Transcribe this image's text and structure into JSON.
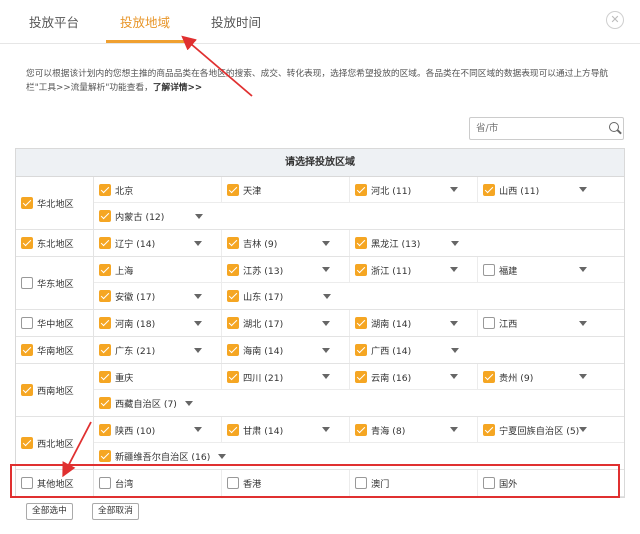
{
  "tabs": [
    {
      "label": "投放平台"
    },
    {
      "label": "投放地域"
    },
    {
      "label": "投放时间"
    }
  ],
  "close_glyph": "✕",
  "description": {
    "text": "您可以根据该计划内的您想主推的商品品类在各地区的搜索、成交、转化表现，选择您希望投放的区域。各品类在不同区域的数据表现可以通过上方导航栏\"工具>>流量解析\"功能查看，",
    "link": "了解详情>>"
  },
  "search": {
    "placeholder": "省/市",
    "icon": "search-icon"
  },
  "grid_title": "请选择投放区域",
  "checkbox_color": "#f5a623",
  "highlight_color": "#e03030",
  "regions": [
    {
      "name": "华北地区",
      "checked": true,
      "rows": [
        [
          {
            "name": "北京",
            "checked": true,
            "dd": false
          },
          {
            "name": "天津",
            "checked": true,
            "dd": false
          },
          {
            "name": "河北 (11)",
            "checked": true,
            "dd": true
          },
          {
            "name": "山西 (11)",
            "checked": true,
            "dd": true
          }
        ],
        [
          {
            "name": "内蒙古 (12)",
            "checked": true,
            "dd": true
          }
        ]
      ]
    },
    {
      "name": "东北地区",
      "checked": true,
      "rows": [
        [
          {
            "name": "辽宁 (14)",
            "checked": true,
            "dd": true
          },
          {
            "name": "吉林 (9)",
            "checked": true,
            "dd": true
          },
          {
            "name": "黑龙江 (13)",
            "checked": true,
            "dd": true
          }
        ]
      ]
    },
    {
      "name": "华东地区",
      "checked": false,
      "rows": [
        [
          {
            "name": "上海",
            "checked": true,
            "dd": false
          },
          {
            "name": "江苏 (13)",
            "checked": true,
            "dd": true
          },
          {
            "name": "浙江 (11)",
            "checked": true,
            "dd": true
          },
          {
            "name": "福建",
            "checked": false,
            "dd": true
          }
        ],
        [
          {
            "name": "安徽 (17)",
            "checked": true,
            "dd": true
          },
          {
            "name": "山东 (17)",
            "checked": true,
            "dd": true
          }
        ]
      ]
    },
    {
      "name": "华中地区",
      "checked": false,
      "rows": [
        [
          {
            "name": "河南 (18)",
            "checked": true,
            "dd": true
          },
          {
            "name": "湖北 (17)",
            "checked": true,
            "dd": true
          },
          {
            "name": "湖南 (14)",
            "checked": true,
            "dd": true
          },
          {
            "name": "江西",
            "checked": false,
            "dd": true
          }
        ]
      ]
    },
    {
      "name": "华南地区",
      "checked": true,
      "rows": [
        [
          {
            "name": "广东 (21)",
            "checked": true,
            "dd": true
          },
          {
            "name": "海南 (14)",
            "checked": true,
            "dd": true
          },
          {
            "name": "广西 (14)",
            "checked": true,
            "dd": true
          }
        ]
      ]
    },
    {
      "name": "西南地区",
      "checked": true,
      "rows": [
        [
          {
            "name": "重庆",
            "checked": true,
            "dd": false
          },
          {
            "name": "四川 (21)",
            "checked": true,
            "dd": true
          },
          {
            "name": "云南 (16)",
            "checked": true,
            "dd": true
          },
          {
            "name": "贵州 (9)",
            "checked": true,
            "dd": true
          }
        ],
        [
          {
            "name": "西藏自治区 (7)",
            "checked": true,
            "dd": true,
            "wide": true
          }
        ]
      ]
    },
    {
      "name": "西北地区",
      "checked": true,
      "rows": [
        [
          {
            "name": "陕西 (10)",
            "checked": true,
            "dd": true
          },
          {
            "name": "甘肃 (14)",
            "checked": true,
            "dd": true
          },
          {
            "name": "青海 (8)",
            "checked": true,
            "dd": true
          },
          {
            "name": "宁夏回族自治区 (5)",
            "checked": true,
            "dd": true
          }
        ],
        [
          {
            "name": "新疆维吾尔自治区 (16)",
            "checked": true,
            "dd": true,
            "wide": true
          }
        ]
      ]
    },
    {
      "name": "其他地区",
      "checked": false,
      "rows": [
        [
          {
            "name": "台湾",
            "checked": false,
            "dd": false
          },
          {
            "name": "香港",
            "checked": false,
            "dd": false
          },
          {
            "name": "澳门",
            "checked": false,
            "dd": false
          },
          {
            "name": "国外",
            "checked": false,
            "dd": false
          }
        ]
      ]
    }
  ],
  "buttons": {
    "select_all": "全部选中",
    "deselect_all": "全部取消"
  }
}
